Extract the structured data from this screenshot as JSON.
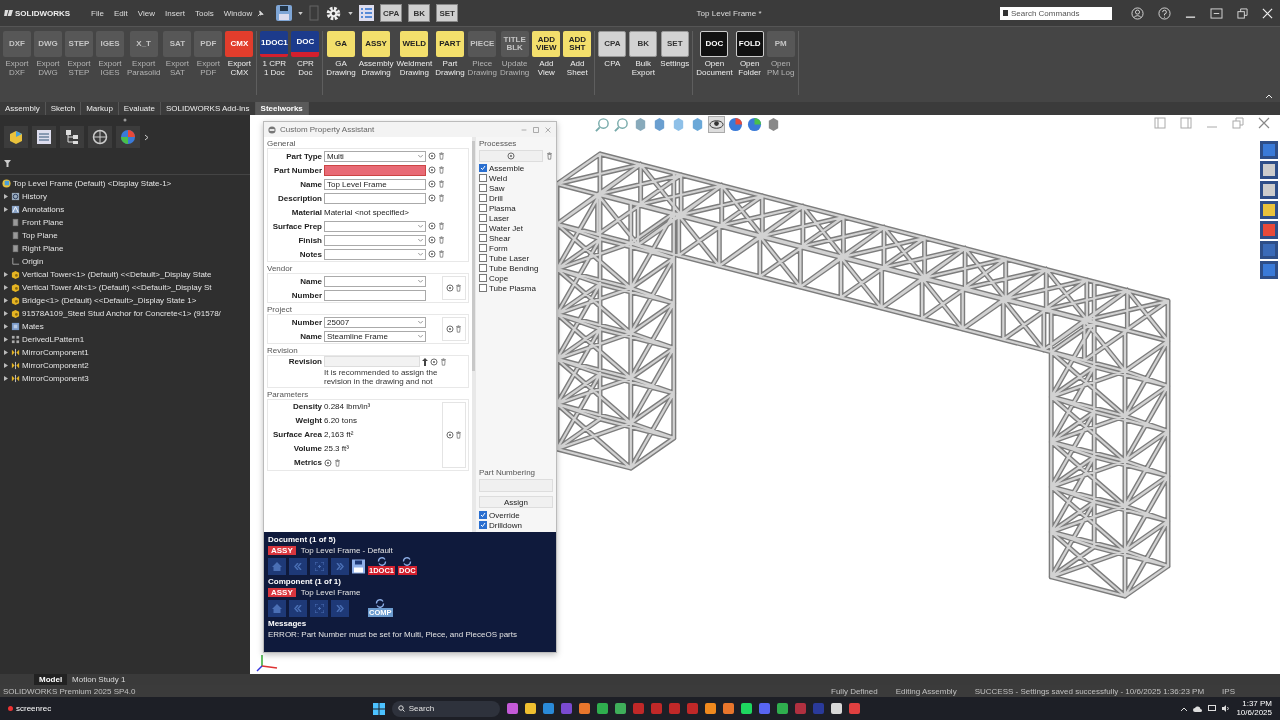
{
  "app": {
    "logo": "SOLIDWORKS",
    "menus": [
      "File",
      "Edit",
      "View",
      "Insert",
      "Tools",
      "Window"
    ],
    "quick_tools": [
      "CPA",
      "BK",
      "SET"
    ],
    "title": "Top Level Frame *",
    "search_placeholder": "Search Commands"
  },
  "ribbon": {
    "groups": [
      [
        {
          "label": "Export DXF",
          "icon_text": "DXF",
          "disabled": true
        },
        {
          "label": "Export DWG",
          "icon_text": "DWG",
          "disabled": true
        },
        {
          "label": "Export STEP",
          "icon_text": "STEP",
          "disabled": true
        },
        {
          "label": "Export IGES",
          "icon_text": "IGES",
          "disabled": true
        },
        {
          "label": "Export Parasolid",
          "icon_text": "X_T",
          "disabled": true
        },
        {
          "label": "Export SAT",
          "icon_text": "SAT",
          "disabled": true
        },
        {
          "label": "Export PDF",
          "icon_text": "PDF",
          "disabled": true
        },
        {
          "label": "Export CMX",
          "icon_text": "CMX",
          "disabled": false
        }
      ],
      [
        {
          "label": "1 CPR 1 Doc",
          "icon_text": "1DOC1",
          "disabled": false
        },
        {
          "label": "CPR Doc",
          "icon_text": "DOC",
          "disabled": false
        }
      ],
      [
        {
          "label": "GA Drawing",
          "icon_text": "GA",
          "disabled": false
        },
        {
          "label": "Assembly Drawing",
          "icon_text": "ASSY",
          "disabled": false
        },
        {
          "label": "Weldment Drawing",
          "icon_text": "WELD",
          "disabled": false
        },
        {
          "label": "Part Drawing",
          "icon_text": "PART",
          "disabled": false
        },
        {
          "label": "Piece Drawing",
          "icon_text": "PIECE",
          "disabled": true
        },
        {
          "label": "Update Drawing",
          "icon_text": "TITLE BLK",
          "disabled": true
        },
        {
          "label": "Add View",
          "icon_text": "ADD VIEW",
          "disabled": false
        },
        {
          "label": "Add Sheet",
          "icon_text": "ADD SHT",
          "disabled": false
        }
      ],
      [
        {
          "label": "CPA",
          "icon_text": "CPA",
          "disabled": false
        },
        {
          "label": "Bulk Export",
          "icon_text": "BK",
          "disabled": false
        },
        {
          "label": "Settings",
          "icon_text": "SET",
          "disabled": false
        }
      ],
      [
        {
          "label": "Open Document",
          "icon_text": "DOC",
          "disabled": false
        },
        {
          "label": "Open Folder",
          "icon_text": "FOLD",
          "disabled": false
        },
        {
          "label": "Open PM Log",
          "icon_text": "PM",
          "disabled": true
        }
      ]
    ]
  },
  "tabs": [
    {
      "label": "Assembly",
      "selected": false
    },
    {
      "label": "Sketch",
      "selected": false
    },
    {
      "label": "Markup",
      "selected": false
    },
    {
      "label": "Evaluate",
      "selected": false
    },
    {
      "label": "SOLIDWORKS Add-Ins",
      "selected": false
    },
    {
      "label": "Steelworks",
      "selected": true
    }
  ],
  "tree": {
    "root": {
      "label": "Top Level Frame (Default) <Display State-1>",
      "kind": "assembly",
      "children": [
        {
          "label": "History",
          "kind": "history",
          "expandable": true
        },
        {
          "label": "Annotations",
          "kind": "annotations",
          "expandable": true
        },
        {
          "label": "Front Plane",
          "kind": "plane",
          "expandable": false
        },
        {
          "label": "Top Plane",
          "kind": "plane",
          "expandable": false
        },
        {
          "label": "Right Plane",
          "kind": "plane",
          "expandable": false
        },
        {
          "label": "Origin",
          "kind": "origin",
          "expandable": false
        },
        {
          "label": "Vertical Tower<1> (Default) <<Default>_Display State",
          "kind": "component",
          "expandable": true
        },
        {
          "label": "Vertical Tower Alt<1> (Default) <<Default>_Display St",
          "kind": "component",
          "expandable": true
        },
        {
          "label": "Bridge<1> (Default) <<Default>_Display State 1>",
          "kind": "component",
          "expandable": true
        },
        {
          "label": "91578A109_Steel Stud Anchor for Concrete<1> (91578/",
          "kind": "component",
          "expandable": true
        },
        {
          "label": "Mates",
          "kind": "mates",
          "expandable": true
        },
        {
          "label": "DerivedLPattern1",
          "kind": "pattern",
          "expandable": true
        },
        {
          "label": "MirrorComponent1",
          "kind": "mirror",
          "expandable": true
        },
        {
          "label": "MirrorComponent2",
          "kind": "mirror",
          "expandable": true
        },
        {
          "label": "MirrorComponent3",
          "kind": "mirror",
          "expandable": true
        }
      ]
    }
  },
  "dialog": {
    "title": "Custom Property Assistant",
    "sections": [
      {
        "title": "General",
        "rows": [
          {
            "label": "Part Type",
            "kind": "select",
            "value": "Multi",
            "error": false
          },
          {
            "label": "Part Number",
            "kind": "input",
            "error": true
          },
          {
            "label": "Name",
            "kind": "input",
            "value": "Top Level Frame",
            "error": false
          },
          {
            "label": "Description",
            "kind": "input",
            "error": false
          },
          {
            "label": "Material",
            "kind": "text",
            "value": "Material <not specified>"
          },
          {
            "label": "Surface Prep",
            "kind": "select",
            "error": false
          },
          {
            "label": "Finish",
            "kind": "select",
            "error": false
          },
          {
            "label": "Notes",
            "kind": "select",
            "error": false
          }
        ]
      },
      {
        "title": "Vendor",
        "rows": [
          {
            "label": "Name",
            "kind": "select",
            "error": false
          },
          {
            "label": "Number",
            "kind": "input",
            "error": false
          }
        ]
      },
      {
        "title": "Project",
        "rows": [
          {
            "label": "Number",
            "kind": "select",
            "value": "25007",
            "error": false
          },
          {
            "label": "Name",
            "kind": "select",
            "value": "Steamline Frame",
            "error": false
          }
        ]
      },
      {
        "title": "Revision",
        "rows": [
          {
            "label": "Revision",
            "kind": "revision",
            "note": "It is recommended to assign the revision in the drawing and not"
          }
        ]
      },
      {
        "title": "Parameters",
        "rows": [
          {
            "label": "Density",
            "kind": "text",
            "value": "0.284 lbm/in³"
          },
          {
            "label": "Weight",
            "kind": "text",
            "value": "6.20 tons"
          },
          {
            "label": "Surface Area",
            "kind": "text",
            "value": "2,163 ft²"
          },
          {
            "label": "Volume",
            "kind": "text",
            "value": "25.3 ft³"
          },
          {
            "label": "Metrics",
            "kind": "text"
          }
        ]
      }
    ],
    "processes": {
      "title": "Processes",
      "items": [
        {
          "label": "Assemble",
          "checked": true
        },
        {
          "label": "Weld",
          "checked": false
        },
        {
          "label": "Saw",
          "checked": false
        },
        {
          "label": "Drill",
          "checked": false
        },
        {
          "label": "Plasma",
          "checked": false
        },
        {
          "label": "Laser",
          "checked": false
        },
        {
          "label": "Water Jet",
          "checked": false
        },
        {
          "label": "Shear",
          "checked": false
        },
        {
          "label": "Form",
          "checked": false
        },
        {
          "label": "Tube Laser",
          "checked": false
        },
        {
          "label": "Tube Bending",
          "checked": false
        },
        {
          "label": "Cope",
          "checked": false
        },
        {
          "label": "Tube Plasma",
          "checked": false
        }
      ]
    },
    "part_numbering": {
      "title": "Part Numbering",
      "button": "Assign",
      "options": [
        {
          "label": "Override",
          "checked": true
        },
        {
          "label": "Drilldown",
          "checked": true
        }
      ]
    },
    "status_panel": {
      "blocks": [
        {
          "title": "Document (1 of 5)",
          "badge": "ASSY",
          "name": "Top Level Frame - Default",
          "refresh": [
            {
              "text": "1DOC1",
              "color": "#d4202e"
            },
            {
              "text": "DOC",
              "color": "#d4202e"
            }
          ]
        },
        {
          "title": "Component (1 of 1)",
          "badge": "ASSY",
          "name": "Top Level Frame",
          "refresh": [
            {
              "text": "COMP",
              "color": "#6c9cd0"
            }
          ]
        }
      ],
      "messages_title": "Messages",
      "message": "ERROR: Part Number must be set for Multi, Piece, and PieceOS parts"
    }
  },
  "bottom_tabs": [
    {
      "label": "Model",
      "selected": true
    },
    {
      "label": "Motion Study 1",
      "selected": false
    }
  ],
  "status_bar": {
    "product": "SOLIDWORKS Premium 2025 SP4.0",
    "items": [
      "Fully Defined",
      "Editing Assembly",
      "SUCCESS - Settings saved successfully - 10/6/2025 1:36:23 PM",
      "IPS"
    ]
  },
  "taskbar": {
    "recorder": "screenrec",
    "search": "Search",
    "time": "1:37 PM",
    "date": "10/6/2025"
  }
}
